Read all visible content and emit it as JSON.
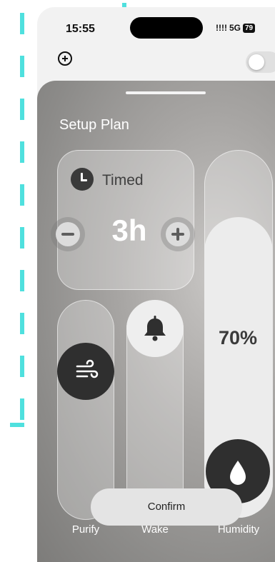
{
  "status_bar": {
    "time": "15:55",
    "signal": "!!!!",
    "network": "5G",
    "battery": "79"
  },
  "sheet": {
    "title": "Setup Plan"
  },
  "timer": {
    "mode_label": "Timed",
    "duration": "3h"
  },
  "controls": {
    "purify_label": "Purify",
    "wake_label": "Wake",
    "humidity_label": "Humidity",
    "humidity_value": "70%"
  },
  "actions": {
    "confirm_label": "Confirm"
  },
  "icons": {
    "clock": "clock-icon",
    "wind": "wind-icon",
    "bell": "bell-icon",
    "water_drop": "water-drop-icon",
    "plus": "plus-icon",
    "minus": "minus-icon"
  }
}
